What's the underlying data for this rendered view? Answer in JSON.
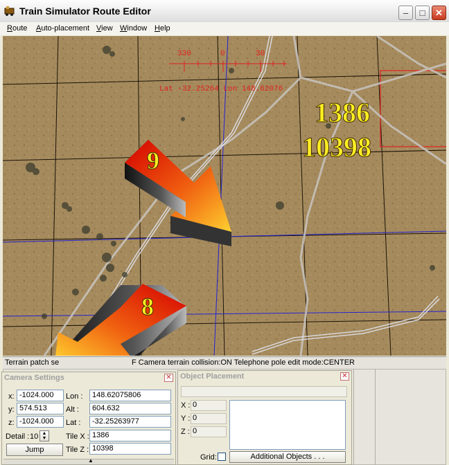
{
  "window": {
    "title": "Train Simulator Route Editor"
  },
  "menu": [
    {
      "label": "Route",
      "underline": "R",
      "rest": "oute"
    },
    {
      "label": "Auto-placement",
      "underline": "A",
      "rest": "uto-placement"
    },
    {
      "label": "View",
      "underline": "V",
      "rest": "iew"
    },
    {
      "label": "Window",
      "underline": "W",
      "rest": "indow"
    },
    {
      "label": "Help",
      "underline": "H",
      "rest": "elp"
    }
  ],
  "compass": {
    "ticks": [
      "330",
      "0",
      "30"
    ],
    "position_text": "Lat -32.25264 Lon 148.62076"
  },
  "overlay": {
    "tile_x": "1386",
    "tile_z": "10398",
    "arrow1_number": "9",
    "arrow2_number": "8",
    "colors": {
      "arrow_red": "#e01010",
      "arrow_orange": "#ffb020",
      "tile_label": "#ffee22",
      "compass": "#ee2222",
      "grid": "#2222cc"
    }
  },
  "status": {
    "text": "Terrain patch selection:OFF Camera terrain collision:ON Telephone pole edit mode:CENTER",
    "visible_left": "Terrain patch se",
    "visible_right": "F Camera terrain collision:ON Telephone pole edit mode:CENTER"
  },
  "camera_settings": {
    "title": "Camera Settings",
    "x_label": "x:",
    "x_value": "-1024.000",
    "y_label": "y:",
    "y_value": "574.513",
    "z_label": "z:",
    "z_value": "-1024.000",
    "lon_label": "Lon :",
    "lon_value": "148.62075806",
    "alt_label": "Alt :",
    "alt_value": "604.632",
    "lat_label": "Lat :",
    "lat_value": "-32.25263977",
    "detail_label": "Detail :",
    "detail_value": "10",
    "tilex_label": "Tile X :",
    "tilex_value": "1386",
    "tilez_label": "Tile Z :",
    "tilez_value": "10398",
    "jump_label": "Jump"
  },
  "object_placement": {
    "title": "Object Placement",
    "x_label": "X :",
    "x_value": "0",
    "y_label": "Y :",
    "y_value": "0",
    "z_label": "Z :",
    "z_value": "0",
    "grid_label": "Grid:",
    "additional_label": "Additional Objects . . ."
  }
}
